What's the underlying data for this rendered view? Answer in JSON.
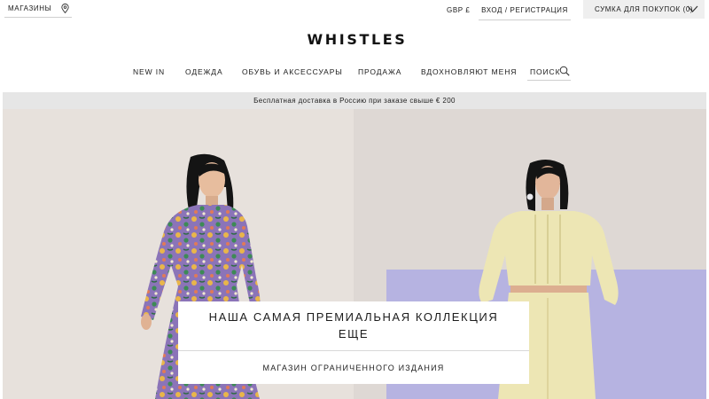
{
  "topbar": {
    "stores_label": "МАГАЗИНЫ",
    "stores_icon": "map-pin-icon",
    "currency": "GBP £",
    "login": "ВХОД / РЕГИСТРАЦИЯ",
    "bag_label": "СУМКА ДЛЯ ПОКУПОК (0)",
    "bag_icon": "chevron-down-icon"
  },
  "brand": {
    "logo": "WHISTLES"
  },
  "nav": {
    "items": [
      "NEW IN",
      "ОДЕЖДА",
      "ОБУВЬ И АКСЕССУАРЫ",
      "ПРОДАЖА",
      "ВДОХНОВЛЯЮТ МЕНЯ"
    ],
    "search_label": "ПОИСК",
    "search_icon": "search-icon"
  },
  "promo": {
    "text": "Бесплатная доставка в Россию при заказе свыше € 200"
  },
  "hero": {
    "headline_line1": "НАША САМАЯ ПРЕМИАЛЬНАЯ КОЛЛЕКЦИЯ",
    "headline_line2": "ЕЩЕ",
    "cta": "МАГАЗИН ОГРАНИЧЕННОГО ИЗДАНИЯ",
    "colors": {
      "left_bg": "#e7e1dc",
      "right_bg": "#ded8d4",
      "lilac": "#b6b3e1",
      "dress_purple": "#8b74b8",
      "knit_yellow": "#ede6b4"
    }
  }
}
